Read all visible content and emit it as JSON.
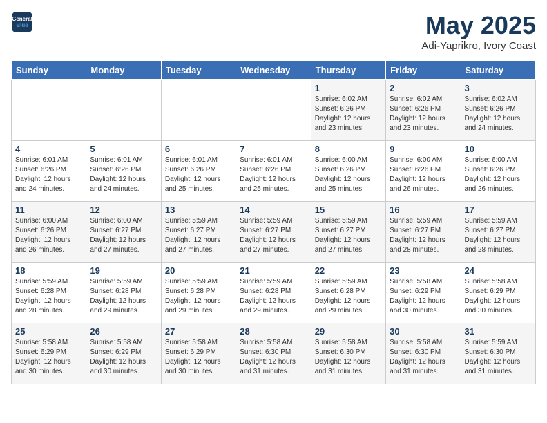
{
  "header": {
    "logo_line1": "General",
    "logo_line2": "Blue",
    "month": "May 2025",
    "location": "Adi-Yaprikro, Ivory Coast"
  },
  "days_of_week": [
    "Sunday",
    "Monday",
    "Tuesday",
    "Wednesday",
    "Thursday",
    "Friday",
    "Saturday"
  ],
  "weeks": [
    [
      {
        "day": "",
        "info": ""
      },
      {
        "day": "",
        "info": ""
      },
      {
        "day": "",
        "info": ""
      },
      {
        "day": "",
        "info": ""
      },
      {
        "day": "1",
        "info": "Sunrise: 6:02 AM\nSunset: 6:26 PM\nDaylight: 12 hours\nand 23 minutes."
      },
      {
        "day": "2",
        "info": "Sunrise: 6:02 AM\nSunset: 6:26 PM\nDaylight: 12 hours\nand 23 minutes."
      },
      {
        "day": "3",
        "info": "Sunrise: 6:02 AM\nSunset: 6:26 PM\nDaylight: 12 hours\nand 24 minutes."
      }
    ],
    [
      {
        "day": "4",
        "info": "Sunrise: 6:01 AM\nSunset: 6:26 PM\nDaylight: 12 hours\nand 24 minutes."
      },
      {
        "day": "5",
        "info": "Sunrise: 6:01 AM\nSunset: 6:26 PM\nDaylight: 12 hours\nand 24 minutes."
      },
      {
        "day": "6",
        "info": "Sunrise: 6:01 AM\nSunset: 6:26 PM\nDaylight: 12 hours\nand 25 minutes."
      },
      {
        "day": "7",
        "info": "Sunrise: 6:01 AM\nSunset: 6:26 PM\nDaylight: 12 hours\nand 25 minutes."
      },
      {
        "day": "8",
        "info": "Sunrise: 6:00 AM\nSunset: 6:26 PM\nDaylight: 12 hours\nand 25 minutes."
      },
      {
        "day": "9",
        "info": "Sunrise: 6:00 AM\nSunset: 6:26 PM\nDaylight: 12 hours\nand 26 minutes."
      },
      {
        "day": "10",
        "info": "Sunrise: 6:00 AM\nSunset: 6:26 PM\nDaylight: 12 hours\nand 26 minutes."
      }
    ],
    [
      {
        "day": "11",
        "info": "Sunrise: 6:00 AM\nSunset: 6:26 PM\nDaylight: 12 hours\nand 26 minutes."
      },
      {
        "day": "12",
        "info": "Sunrise: 6:00 AM\nSunset: 6:27 PM\nDaylight: 12 hours\nand 27 minutes."
      },
      {
        "day": "13",
        "info": "Sunrise: 5:59 AM\nSunset: 6:27 PM\nDaylight: 12 hours\nand 27 minutes."
      },
      {
        "day": "14",
        "info": "Sunrise: 5:59 AM\nSunset: 6:27 PM\nDaylight: 12 hours\nand 27 minutes."
      },
      {
        "day": "15",
        "info": "Sunrise: 5:59 AM\nSunset: 6:27 PM\nDaylight: 12 hours\nand 27 minutes."
      },
      {
        "day": "16",
        "info": "Sunrise: 5:59 AM\nSunset: 6:27 PM\nDaylight: 12 hours\nand 28 minutes."
      },
      {
        "day": "17",
        "info": "Sunrise: 5:59 AM\nSunset: 6:27 PM\nDaylight: 12 hours\nand 28 minutes."
      }
    ],
    [
      {
        "day": "18",
        "info": "Sunrise: 5:59 AM\nSunset: 6:28 PM\nDaylight: 12 hours\nand 28 minutes."
      },
      {
        "day": "19",
        "info": "Sunrise: 5:59 AM\nSunset: 6:28 PM\nDaylight: 12 hours\nand 29 minutes."
      },
      {
        "day": "20",
        "info": "Sunrise: 5:59 AM\nSunset: 6:28 PM\nDaylight: 12 hours\nand 29 minutes."
      },
      {
        "day": "21",
        "info": "Sunrise: 5:59 AM\nSunset: 6:28 PM\nDaylight: 12 hours\nand 29 minutes."
      },
      {
        "day": "22",
        "info": "Sunrise: 5:59 AM\nSunset: 6:28 PM\nDaylight: 12 hours\nand 29 minutes."
      },
      {
        "day": "23",
        "info": "Sunrise: 5:58 AM\nSunset: 6:29 PM\nDaylight: 12 hours\nand 30 minutes."
      },
      {
        "day": "24",
        "info": "Sunrise: 5:58 AM\nSunset: 6:29 PM\nDaylight: 12 hours\nand 30 minutes."
      }
    ],
    [
      {
        "day": "25",
        "info": "Sunrise: 5:58 AM\nSunset: 6:29 PM\nDaylight: 12 hours\nand 30 minutes."
      },
      {
        "day": "26",
        "info": "Sunrise: 5:58 AM\nSunset: 6:29 PM\nDaylight: 12 hours\nand 30 minutes."
      },
      {
        "day": "27",
        "info": "Sunrise: 5:58 AM\nSunset: 6:29 PM\nDaylight: 12 hours\nand 30 minutes."
      },
      {
        "day": "28",
        "info": "Sunrise: 5:58 AM\nSunset: 6:30 PM\nDaylight: 12 hours\nand 31 minutes."
      },
      {
        "day": "29",
        "info": "Sunrise: 5:58 AM\nSunset: 6:30 PM\nDaylight: 12 hours\nand 31 minutes."
      },
      {
        "day": "30",
        "info": "Sunrise: 5:58 AM\nSunset: 6:30 PM\nDaylight: 12 hours\nand 31 minutes."
      },
      {
        "day": "31",
        "info": "Sunrise: 5:59 AM\nSunset: 6:30 PM\nDaylight: 12 hours\nand 31 minutes."
      }
    ]
  ]
}
